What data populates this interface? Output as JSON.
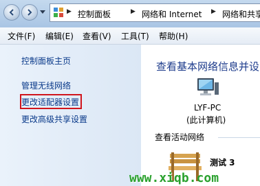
{
  "address_bar": {
    "breadcrumbs": [
      "控制面板",
      "网络和 Internet",
      "网络和共享中"
    ]
  },
  "menu": {
    "items": [
      "文件(F)",
      "编辑(E)",
      "查看(V)",
      "工具(T)",
      "帮助(H)"
    ]
  },
  "left_pane": {
    "links": [
      "控制面板主页",
      "管理无线网络",
      "更改适配器设置",
      "更改高级共享设置"
    ],
    "highlighted_link_index": 2
  },
  "main": {
    "heading": "查看基本网络信息并设",
    "computer": {
      "name": "LYF-PC",
      "subtitle": "(此计算机)"
    },
    "active_networks_label": "查看活动网络",
    "network_name": "测试  3"
  },
  "watermark": "www.xiqb.com",
  "colors": {
    "link": "#0a3a8a",
    "heading": "#1e3c8c",
    "highlight_border": "#d0141c",
    "watermark": "#2aa12e"
  }
}
